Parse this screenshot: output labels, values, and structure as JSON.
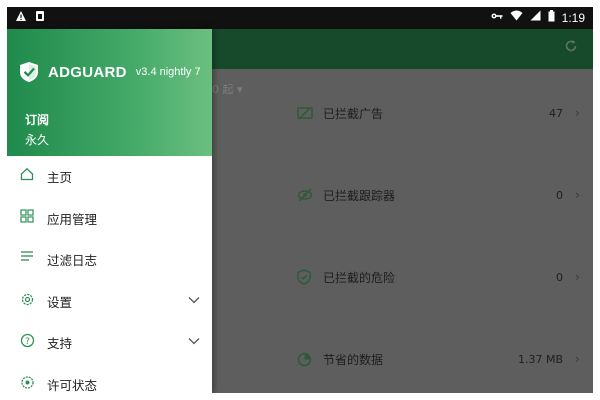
{
  "status_bar": {
    "time": "1:19",
    "left_icons": [
      "warning-icon",
      "sim-icon"
    ],
    "right_icons": [
      "key-icon",
      "wifi-icon",
      "signal-icon",
      "battery-icon"
    ]
  },
  "drawer": {
    "brand": "ADGUARD",
    "version": "v3.4 nightly 7",
    "subscription_label": "订阅",
    "subscription_value": "永久",
    "items": [
      {
        "label": "主页",
        "icon": "home-icon",
        "expandable": false
      },
      {
        "label": "应用管理",
        "icon": "apps-grid-icon",
        "expandable": false
      },
      {
        "label": "过滤日志",
        "icon": "list-icon",
        "expandable": false
      },
      {
        "label": "设置",
        "icon": "gear-icon",
        "expandable": true
      },
      {
        "label": "支持",
        "icon": "help-icon",
        "expandable": true
      },
      {
        "label": "许可状态",
        "icon": "license-icon",
        "expandable": false
      }
    ]
  },
  "main": {
    "filter_chip": "00 起 ▾",
    "stats": [
      {
        "label": "已拦截广告",
        "value": "47",
        "icon": "ad-block-icon"
      },
      {
        "label": "已拦截跟踪器",
        "value": "0",
        "icon": "eye-off-icon"
      },
      {
        "label": "已拦截的危险",
        "value": "0",
        "icon": "shield-icon"
      },
      {
        "label": "节省的数据",
        "value": "1.37 MB",
        "icon": "pie-chart-icon"
      }
    ]
  },
  "colors": {
    "accent": "#2e8f56",
    "header_gradient_start": "#1f8a4c",
    "header_gradient_end": "#6bbf80",
    "toolbar_dim": "#17492b",
    "scrim_bg": "#5e5e5e"
  }
}
